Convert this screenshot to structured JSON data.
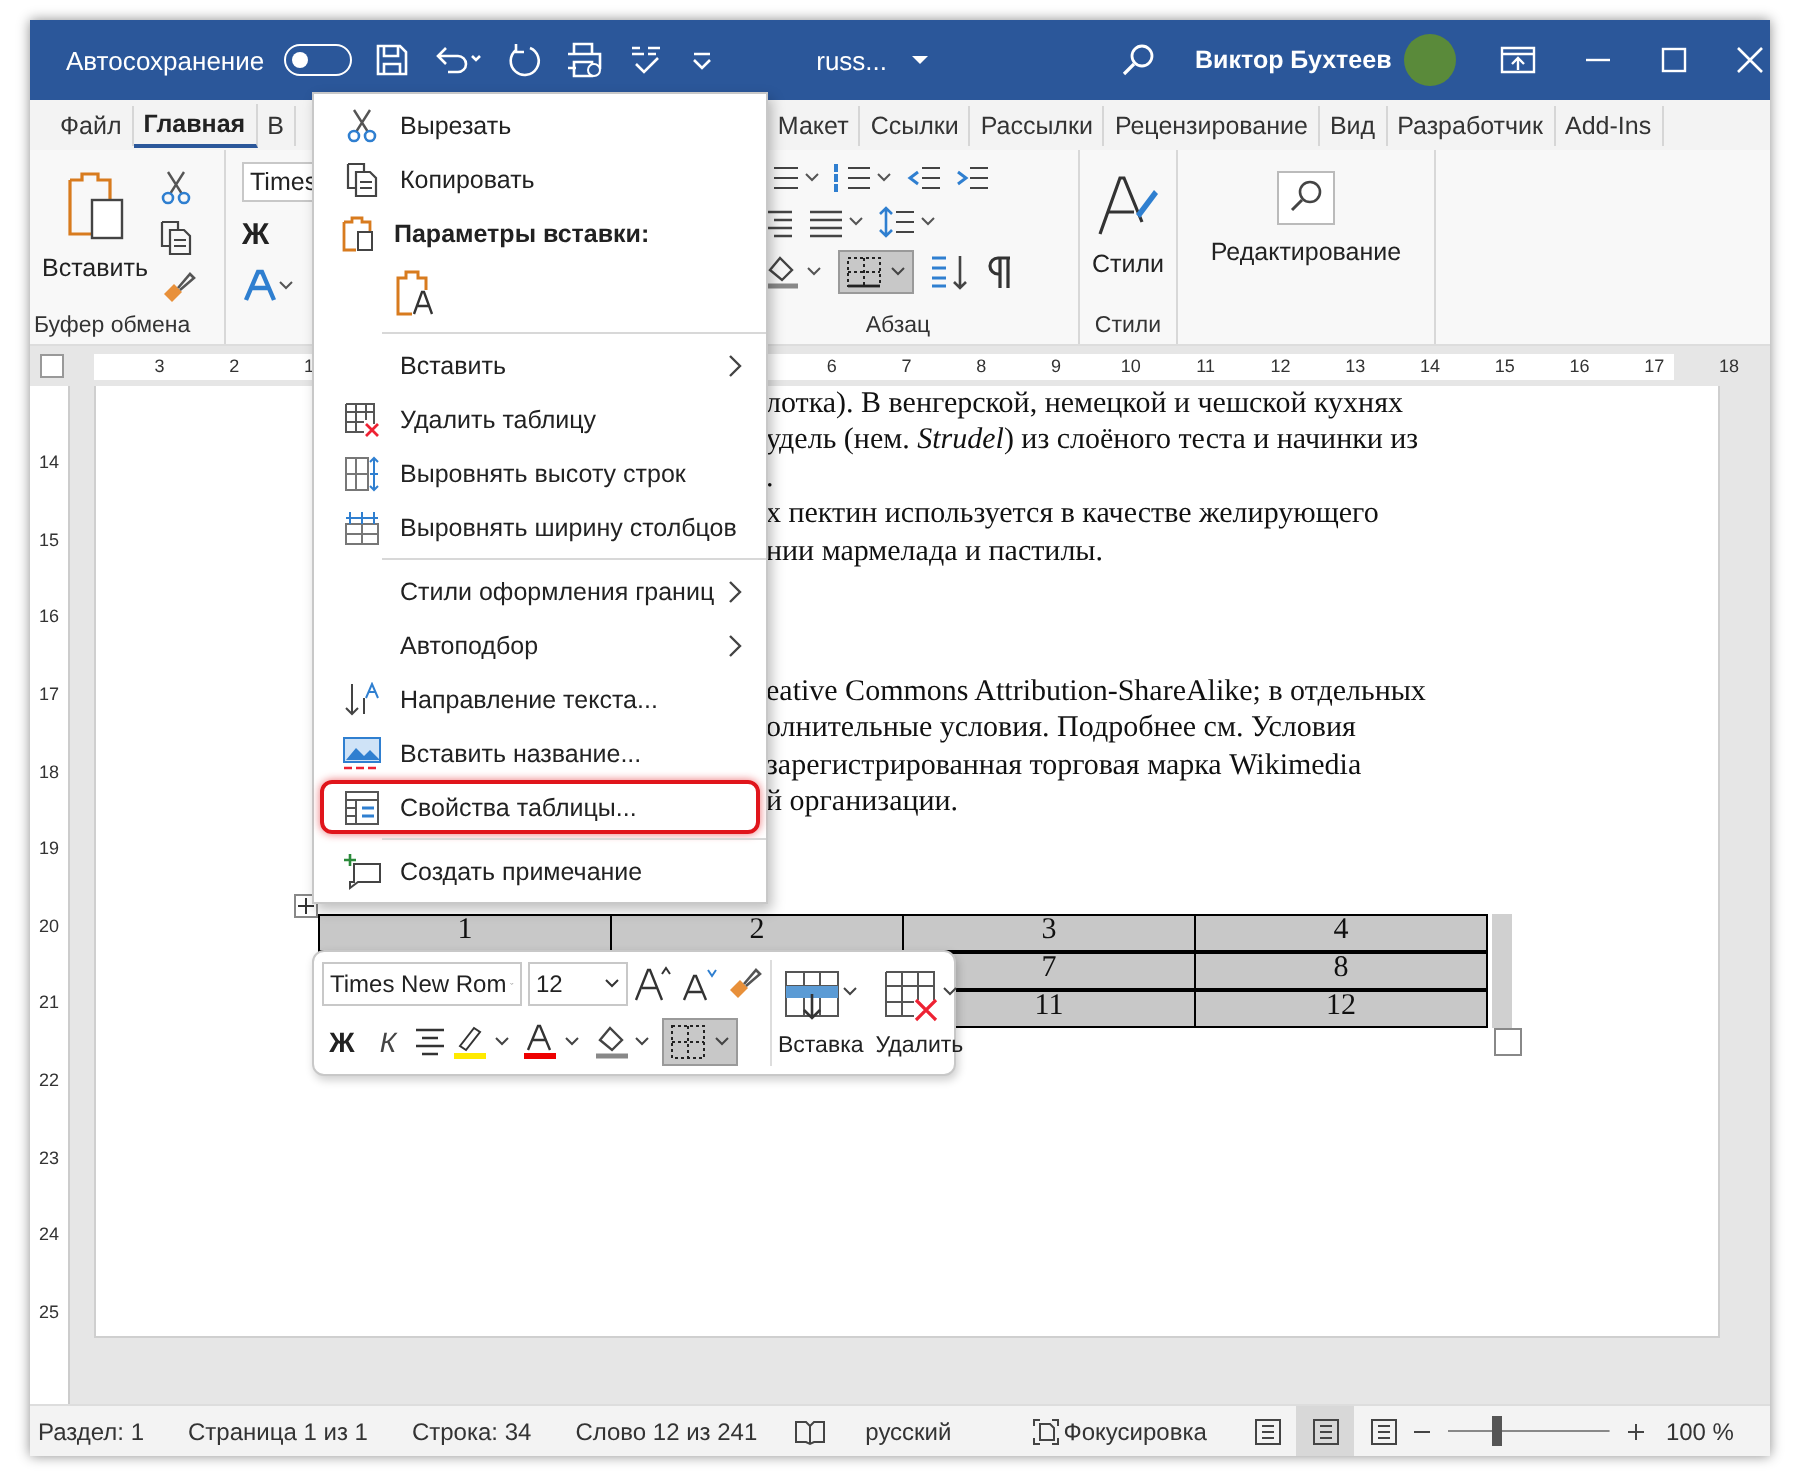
{
  "title_bar": {
    "autosave_label": "Автосохранение",
    "autosave_on": false,
    "document_name": "russ...",
    "user_name": "Виктор Бухтеев"
  },
  "ribbon_tabs": [
    {
      "label": "Файл",
      "selected": false
    },
    {
      "label": "Главная",
      "selected": true
    },
    {
      "label": "В",
      "selected": false
    },
    {
      "label": "Макет",
      "selected": false
    },
    {
      "label": "Ссылки",
      "selected": false
    },
    {
      "label": "Рассылки",
      "selected": false
    },
    {
      "label": "Рецензирование",
      "selected": false
    },
    {
      "label": "Вид",
      "selected": false
    },
    {
      "label": "Разработчик",
      "selected": false
    },
    {
      "label": "Add-Ins",
      "selected": false
    }
  ],
  "ribbon": {
    "paste_label": "Вставить",
    "clipboard_group": "Буфер обмена",
    "font_name": "Times",
    "bold_key": "Ж",
    "paragraph_group": "Абзац",
    "styles_label": "Стили",
    "styles_group": "Стили",
    "editing_label": "Редактирование",
    "borders_selected": true
  },
  "horizontal_ruler": {
    "left_numbers": [
      "3",
      "2",
      "1"
    ],
    "right_numbers": [
      "6",
      "7",
      "8",
      "9",
      "10",
      "11",
      "12",
      "13",
      "14",
      "15",
      "16",
      "17",
      "18"
    ]
  },
  "vertical_ruler": [
    "14",
    "15",
    "16",
    "17",
    "18",
    "19",
    "20",
    "21",
    "22",
    "23",
    "24",
    "25"
  ],
  "document": {
    "paragraphs": [
      {
        "lines": [
          "лотка). В венгерской, немецкой и чешской кухнях",
          "удель (нем. *Strudel*) из слоёного теста и начинки из",
          ".",
          "х пектин используется в качестве желирующего",
          "нии мармелада и пастилы."
        ]
      },
      {
        "lines": [
          "eative Commons Attribution-ShareAlike; в отдельных",
          "олнительные условия. Подробнее см. Условия",
          "зарегистрированная торговая марка Wikimedia",
          "й организации."
        ]
      }
    ],
    "table": {
      "rows": [
        [
          "1",
          "2",
          "3",
          "4"
        ],
        [
          "7",
          "8"
        ],
        [
          "11",
          "12"
        ]
      ]
    }
  },
  "context_menu": [
    {
      "kind": "item",
      "label": "Вырезать",
      "submenu": false,
      "highlighted": false
    },
    {
      "kind": "item",
      "label": "Копировать",
      "submenu": false,
      "highlighted": false
    },
    {
      "kind": "header",
      "label": "Параметры вставки:"
    },
    {
      "kind": "paste_options"
    },
    {
      "kind": "separator"
    },
    {
      "kind": "item",
      "label": "Вставить",
      "submenu": true,
      "highlighted": false
    },
    {
      "kind": "item",
      "label": "Удалить таблицу",
      "submenu": false,
      "highlighted": false
    },
    {
      "kind": "item",
      "label": "Выровнять высоту строк",
      "submenu": false,
      "highlighted": false
    },
    {
      "kind": "item",
      "label": "Выровнять ширину столбцов",
      "submenu": false,
      "highlighted": false
    },
    {
      "kind": "separator"
    },
    {
      "kind": "item",
      "label": "Стили оформления границ",
      "submenu": true,
      "highlighted": false
    },
    {
      "kind": "item",
      "label": "Автоподбор",
      "submenu": true,
      "highlighted": false
    },
    {
      "kind": "item",
      "label": "Направление текста...",
      "submenu": false,
      "highlighted": false
    },
    {
      "kind": "item",
      "label": "Вставить название...",
      "submenu": false,
      "highlighted": false
    },
    {
      "kind": "item",
      "label": "Свойства таблицы...",
      "submenu": false,
      "highlighted": true
    },
    {
      "kind": "separator"
    },
    {
      "kind": "item",
      "label": "Создать примечание",
      "submenu": false,
      "highlighted": false
    }
  ],
  "mini_toolbar": {
    "font": "Times New Rom",
    "size": "12",
    "bold": "Ж",
    "italic": "К",
    "borders_selected": true,
    "insert_label": "Вставка",
    "delete_label": "Удалить"
  },
  "status_bar": {
    "items": [
      "Раздел: 1",
      "Страница 1 из 1",
      "Строка: 34",
      "Слово 12 из 241"
    ],
    "language": "русский",
    "focus_label": "Фокусировка",
    "views": [
      {
        "selected": false
      },
      {
        "selected": true
      },
      {
        "selected": false
      }
    ],
    "zoom": {
      "level": 0.27,
      "label": "100 %"
    }
  }
}
